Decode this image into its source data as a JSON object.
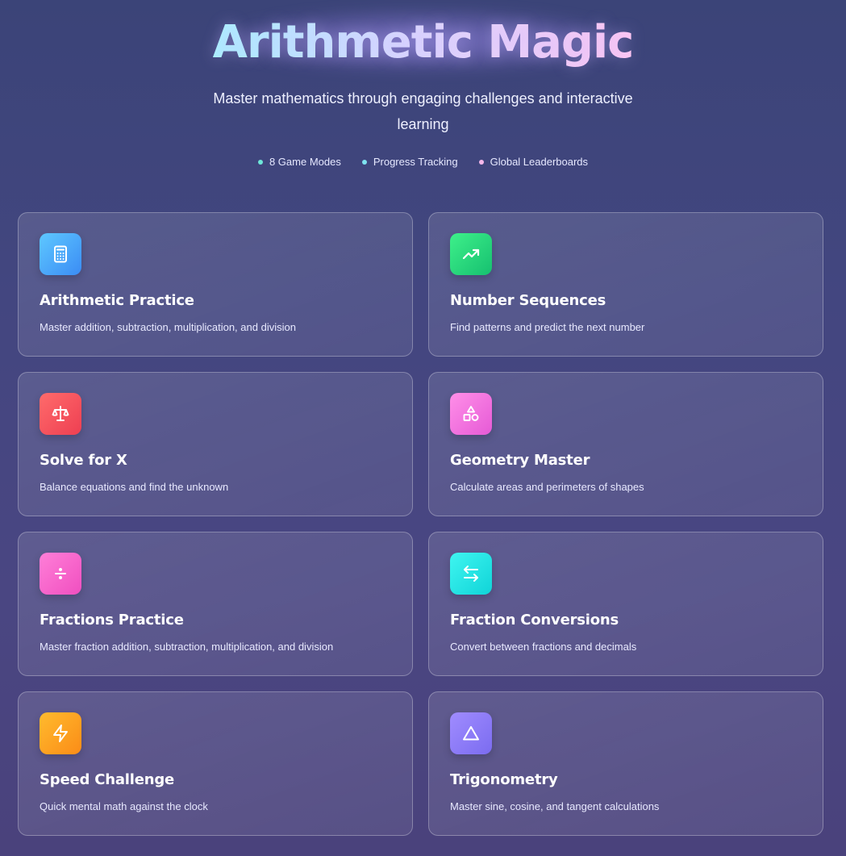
{
  "header": {
    "title": "Arithmetic Magic",
    "subtitle": "Master mathematics through engaging challenges and interactive learning",
    "features": [
      {
        "label": "8 Game Modes",
        "color": "#6ee7d9"
      },
      {
        "label": "Progress Tracking",
        "color": "#7fe3f0"
      },
      {
        "label": "Global Leaderboards",
        "color": "#f5b8ea"
      }
    ]
  },
  "cards": [
    {
      "title": "Arithmetic Practice",
      "description": "Master addition, subtraction, multiplication, and division",
      "icon": "calculator-icon",
      "color_from": "#5ec8ff",
      "color_to": "#3b8cf5"
    },
    {
      "title": "Number Sequences",
      "description": "Find patterns and predict the next number",
      "icon": "trending-up-icon",
      "color_from": "#3ef08a",
      "color_to": "#16c070"
    },
    {
      "title": "Solve for X",
      "description": "Balance equations and find the unknown",
      "icon": "scale-icon",
      "color_from": "#ff6b6b",
      "color_to": "#ee3f52"
    },
    {
      "title": "Geometry Master",
      "description": "Calculate areas and perimeters of shapes",
      "icon": "shapes-icon",
      "color_from": "#ff8fe8",
      "color_to": "#e65ad6"
    },
    {
      "title": "Fractions Practice",
      "description": "Master fraction addition, subtraction, multiplication, and division",
      "icon": "divide-icon",
      "color_from": "#ff7fd8",
      "color_to": "#f04fc0"
    },
    {
      "title": "Fraction Conversions",
      "description": "Convert between fractions and decimals",
      "icon": "arrows-exchange-icon",
      "color_from": "#3ff5f0",
      "color_to": "#10d4d8"
    },
    {
      "title": "Speed Challenge",
      "description": "Quick mental math against the clock",
      "icon": "lightning-icon",
      "color_from": "#ffbb2e",
      "color_to": "#fb8c17"
    },
    {
      "title": "Trigonometry",
      "description": "Master sine, cosine, and tangent calculations",
      "icon": "triangle-icon",
      "color_from": "#a08cff",
      "color_to": "#7b6cf0"
    }
  ]
}
